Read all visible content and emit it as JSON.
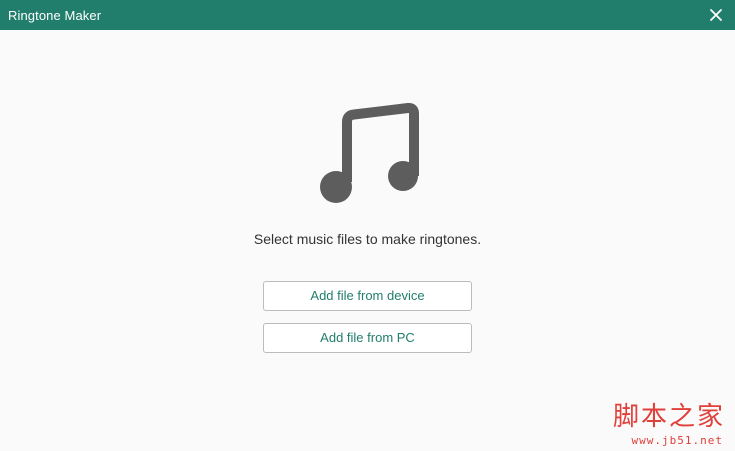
{
  "window": {
    "title": "Ringtone Maker",
    "close_icon": "close-icon",
    "titlebar_color": "#217e6c"
  },
  "main": {
    "icon": "music-note-icon",
    "prompt": "Select music files to make ringtones.",
    "buttons": {
      "device_label": "Add file from device",
      "pc_label": "Add file from PC"
    },
    "accent_color": "#217e6c"
  },
  "watermark": {
    "text": "脚本之家",
    "url": "www.jb51.net"
  }
}
